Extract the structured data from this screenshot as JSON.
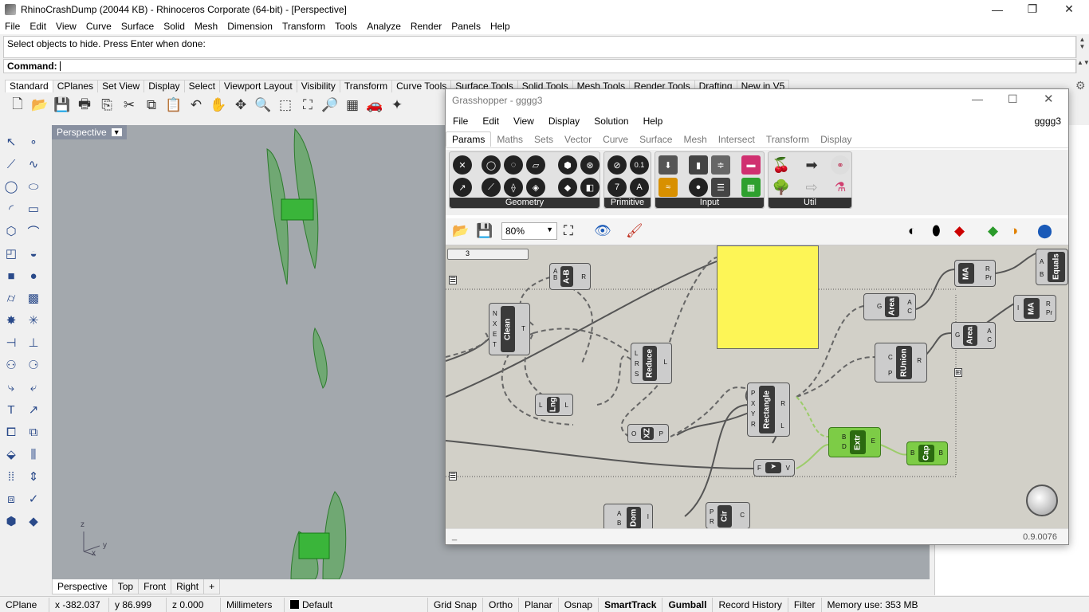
{
  "window": {
    "title": "RhinoCrashDump (20044 KB) - Rhinoceros Corporate (64-bit) - [Perspective]",
    "minimize": "—",
    "maximize": "❐",
    "close": "✕"
  },
  "menu": [
    "File",
    "Edit",
    "View",
    "Curve",
    "Surface",
    "Solid",
    "Mesh",
    "Dimension",
    "Transform",
    "Tools",
    "Analyze",
    "Render",
    "Panels",
    "Help"
  ],
  "command": {
    "history": "Select objects to hide. Press Enter when done:",
    "prompt": "Command:"
  },
  "toolbar_tabs": [
    "Standard",
    "CPlanes",
    "Set View",
    "Display",
    "Select",
    "Viewport Layout",
    "Visibility",
    "Transform",
    "Curve Tools",
    "Surface Tools",
    "Solid Tools",
    "Mesh Tools",
    "Render Tools",
    "Drafting",
    "New in V5"
  ],
  "toolbar_icons": [
    "new-icon",
    "open-icon",
    "save-icon",
    "print-icon",
    "import-icon",
    "cut-icon",
    "copy-icon",
    "paste-icon",
    "undo-icon",
    "pan-icon",
    "rotate-icon",
    "zoom-icon",
    "zoom-window-icon",
    "zoom-extents-icon",
    "zoom-selected-icon",
    "grid-icon",
    "car-icon",
    "render-icon"
  ],
  "viewport": {
    "label": "Perspective",
    "axis_y": "y",
    "axis_z": "z",
    "axis_x": "x"
  },
  "viewport_tabs": [
    "Perspective",
    "Top",
    "Front",
    "Right",
    "+"
  ],
  "status": {
    "cplane": "CPlane",
    "x": "x -382.037",
    "y": "y 86.999",
    "z": "z 0.000",
    "units": "Millimeters",
    "layer": "Default",
    "grid_snap": "Grid Snap",
    "ortho": "Ortho",
    "planar": "Planar",
    "osnap": "Osnap",
    "smarttrack": "SmartTrack",
    "gumball": "Gumball",
    "record_history": "Record History",
    "filter": "Filter",
    "memory": "Memory use: 353 MB"
  },
  "grasshopper": {
    "title": "Grasshopper - gggg3",
    "menu": [
      "File",
      "Edit",
      "View",
      "Display",
      "Solution",
      "Help"
    ],
    "doc_name": "gggg3",
    "tabs": [
      "Params",
      "Maths",
      "Sets",
      "Vector",
      "Curve",
      "Surface",
      "Mesh",
      "Intersect",
      "Transform",
      "Display"
    ],
    "groups": [
      "Geometry",
      "Primitive",
      "Input",
      "Util"
    ],
    "zoom": "80%",
    "version": "0.9.0076",
    "status_left": "_",
    "slider_value": "3",
    "components": [
      {
        "id": "ab",
        "label": "A-B",
        "inputs": "A\nB",
        "outputs": "R"
      },
      {
        "id": "clean",
        "label": "Clean",
        "inputs": "N\nX\nE\nT",
        "outputs": "T"
      },
      {
        "id": "reduce",
        "label": "Reduce",
        "inputs": "L\nR\nS",
        "outputs": "L"
      },
      {
        "id": "lng",
        "label": "Lng",
        "inputs": "L",
        "outputs": "L"
      },
      {
        "id": "xz",
        "label": "XZ",
        "inputs": "O",
        "outputs": "P"
      },
      {
        "id": "rect",
        "label": "Rectangle",
        "inputs": "P\nX\nY\nR",
        "outputs": "R\nL"
      },
      {
        "id": "area1",
        "label": "Area",
        "inputs": "G",
        "outputs": "A\nC"
      },
      {
        "id": "runion",
        "label": "RUnion",
        "inputs": "C\nP",
        "outputs": "R"
      },
      {
        "id": "area2",
        "label": "Area",
        "inputs": "G",
        "outputs": "A\nC"
      },
      {
        "id": "ma1",
        "label": "MA",
        "inputs": "",
        "outputs": "R\nPr"
      },
      {
        "id": "ma2",
        "label": "MA",
        "inputs": "I",
        "outputs": "R\nPr"
      },
      {
        "id": "equals",
        "label": "Equals",
        "inputs": "A\nB",
        "outputs": ""
      },
      {
        "id": "extr",
        "label": "Extr",
        "inputs": "B\nD",
        "outputs": "E"
      },
      {
        "id": "cap",
        "label": "Cap",
        "inputs": "B",
        "outputs": "B"
      },
      {
        "id": "fv",
        "label": "",
        "inputs": "F",
        "outputs": "V"
      },
      {
        "id": "dom",
        "label": "Dom",
        "inputs": "A\nB",
        "outputs": "I"
      },
      {
        "id": "cir",
        "label": "Cir",
        "inputs": "P\nR",
        "outputs": "C"
      }
    ]
  }
}
